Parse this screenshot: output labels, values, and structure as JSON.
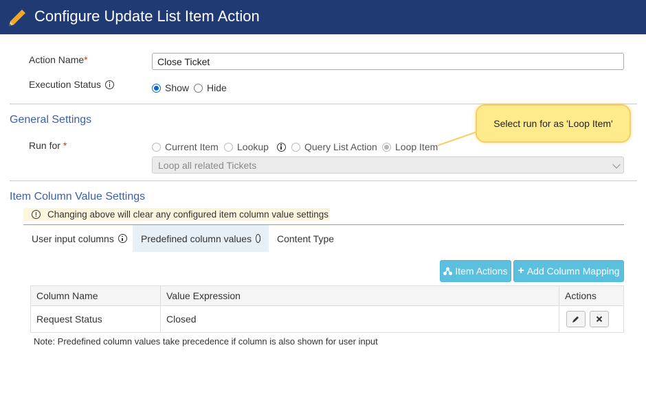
{
  "header": {
    "title": "Configure Update List Item Action",
    "icon": "pencil-icon",
    "background": "#203a73"
  },
  "form": {
    "action_name_label": "Action Name",
    "required_mark": "*",
    "action_name_value": "Close Ticket",
    "execution_status_label": "Execution Status",
    "execution_options": [
      {
        "label": "Show",
        "checked": true
      },
      {
        "label": "Hide",
        "checked": false
      }
    ]
  },
  "general_settings": {
    "title": "General Settings",
    "run_for_label": "Run for",
    "required_mark": "*",
    "run_for_options": [
      {
        "label": "Current Item",
        "checked": false
      },
      {
        "label": "Lookup",
        "checked": false
      },
      {
        "label": "Query List Action",
        "checked": false
      },
      {
        "label": "Loop Item",
        "checked": true
      }
    ],
    "loop_select_value": "Loop all related Tickets",
    "callout_text": "Select run for as 'Loop Item'"
  },
  "item_column_settings": {
    "title": "Item Column Value Settings",
    "warning_text": "Changing above will clear any configured item column value settings",
    "tabs": [
      {
        "label": "User input columns",
        "active": false
      },
      {
        "label": "Predefined column values",
        "active": true
      },
      {
        "label": "Content Type",
        "active": false
      }
    ],
    "buttons": {
      "item_actions": "Item Actions",
      "add_column_mapping": "Add Column Mapping"
    },
    "table": {
      "headers": [
        "Column Name",
        "Value Expression",
        "Actions"
      ],
      "rows": [
        {
          "column_name": "Request Status",
          "value_expression": "Closed"
        }
      ]
    },
    "note": "Note: Predefined column values take precedence if column is also shown for user input"
  },
  "colors": {
    "accent": "#3a5fa8",
    "info_button": "#5bc0de",
    "callout": "#ffeb8c"
  }
}
